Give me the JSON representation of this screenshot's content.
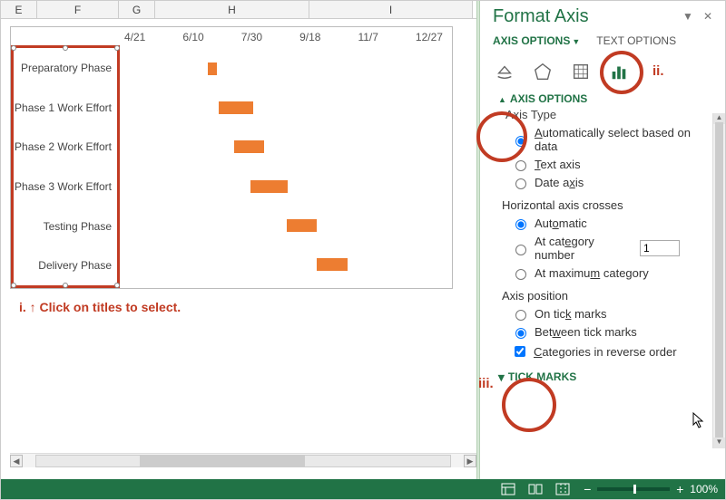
{
  "columns": [
    "E",
    "F",
    "G",
    "H",
    "I"
  ],
  "annotations": {
    "i": "i. ↑ Click on titles to select.",
    "ii": "ii.",
    "iii": "iii."
  },
  "chart_data": {
    "type": "bar",
    "orientation": "horizontal",
    "categories": [
      "Preparatory Phase",
      "Phase 1 Work Effort",
      "Phase 2 Work Effort",
      "Phase 3 Work Effort",
      "Testing Phase",
      "Delivery Phase"
    ],
    "x_ticks": [
      "4/21",
      "6/10",
      "7/30",
      "9/18",
      "11/7",
      "12/27"
    ],
    "start": [
      0.263,
      0.295,
      0.345,
      0.397,
      0.51,
      0.605
    ],
    "width": [
      0.028,
      0.11,
      0.095,
      0.115,
      0.095,
      0.095
    ]
  },
  "pane": {
    "title": "Format Axis",
    "tab_active": "AXIS OPTIONS",
    "tab_inactive": "TEXT OPTIONS",
    "section_axis_options": "AXIS OPTIONS",
    "axis_type_label": "Axis Type",
    "opt_auto": "Automatically select based on data",
    "opt_text": "Text axis",
    "opt_date": "Date axis",
    "h_crosses_label": "Horizontal axis crosses",
    "opt_h_auto": "Automatic",
    "opt_h_cat": "At category number",
    "h_cat_value": "1",
    "opt_h_max": "At maximum category",
    "axis_pos_label": "Axis position",
    "opt_on_tick": "On tick marks",
    "opt_between": "Between tick marks",
    "opt_reverse": "Categories in reverse order",
    "section_tick_marks": "TICK MARKS"
  },
  "status": {
    "zoom_label": "100%"
  },
  "icons": {
    "fill": "paint-bucket-icon",
    "effects": "pentagon-icon",
    "size": "size-properties-icon",
    "chart": "chart-icon"
  }
}
